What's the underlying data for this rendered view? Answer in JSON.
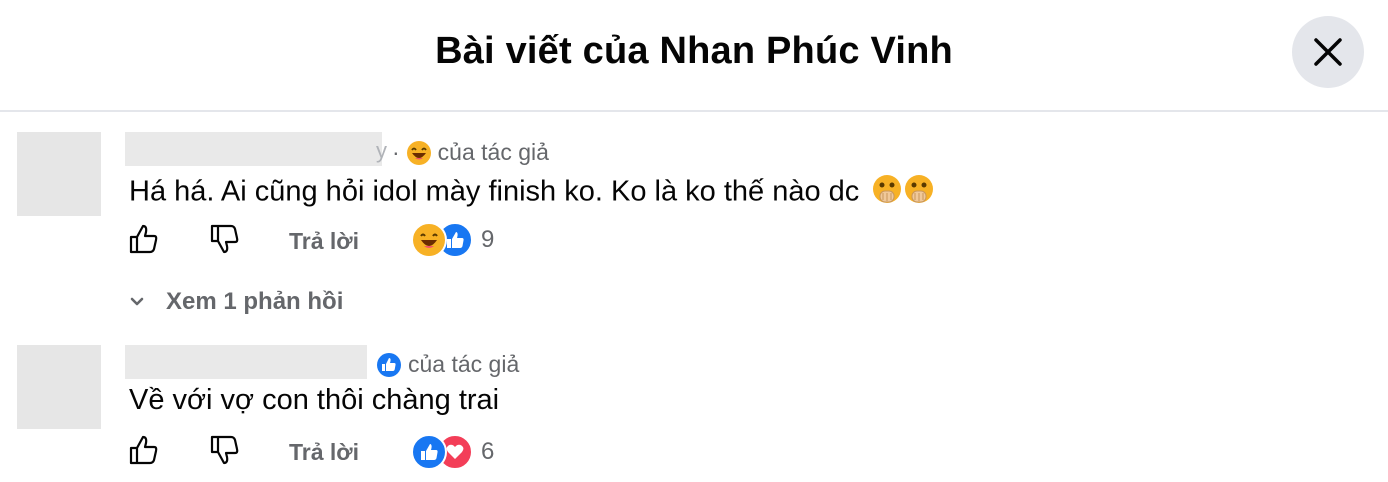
{
  "header": {
    "title": "Bài viết của Nhan Phúc Vinh"
  },
  "comments": [
    {
      "author_tail": "y",
      "meta_separator": "·",
      "author_badge": "của tác giả",
      "author_badge_icon": "laughing-emoji-icon",
      "text": "Há há. Ai cũng hỏi idol mày finish ko. Ko là ko thế nào dc",
      "text_emojis": [
        "hand-over-mouth-emoji-icon",
        "hand-over-mouth-emoji-icon"
      ],
      "reply_label": "Trả lời",
      "reactions": [
        "haha",
        "like"
      ],
      "reaction_count": "9",
      "view_replies": "Xem 1 phản hồi"
    },
    {
      "author_tail": "",
      "author_badge": "của tác giả",
      "author_badge_icon": "like-icon",
      "text": "Về với vợ con thôi chàng trai",
      "reply_label": "Trả lời",
      "reactions": [
        "like",
        "love"
      ],
      "reaction_count": "6"
    }
  ],
  "colors": {
    "like_blue": "#1877f2",
    "love_red": "#f33e58",
    "haha_yellow": "#f7b125",
    "secondary_text": "#65676b"
  }
}
